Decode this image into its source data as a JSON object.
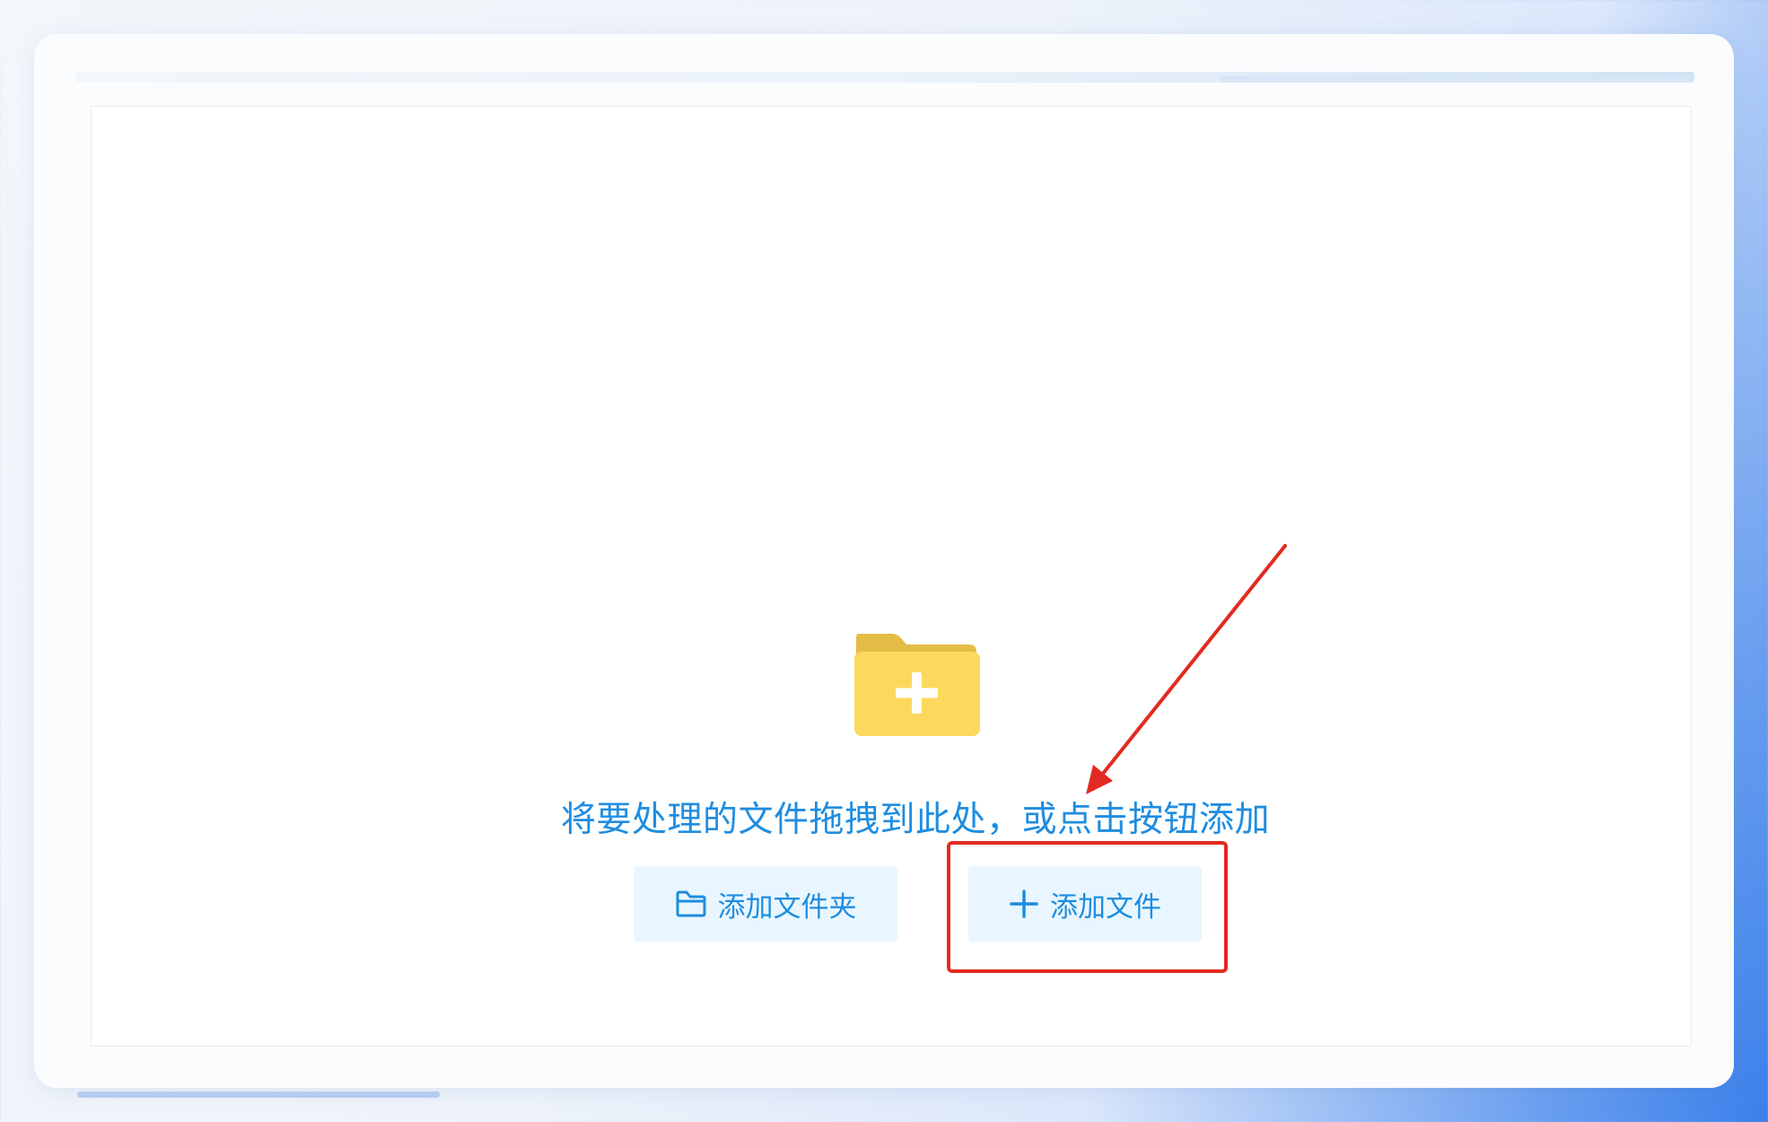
{
  "dropzone": {
    "hint_text": "将要处理的文件拖拽到此处，或点击按钮添加",
    "folder_icon": "folder-plus-icon"
  },
  "buttons": {
    "add_folder_label": "添加文件夹",
    "add_folder_icon": "folder-outline-icon",
    "add_file_label": "添加文件",
    "add_file_icon": "plus-icon"
  },
  "annotation": {
    "highlight_color": "#e22b22",
    "arrow_color": "#e22b22"
  },
  "colors": {
    "accent_text": "#1f8de0",
    "button_bg": "#e9f6ff",
    "folder_yellow": "#fcd95c",
    "folder_tab": "#e4bd47"
  }
}
